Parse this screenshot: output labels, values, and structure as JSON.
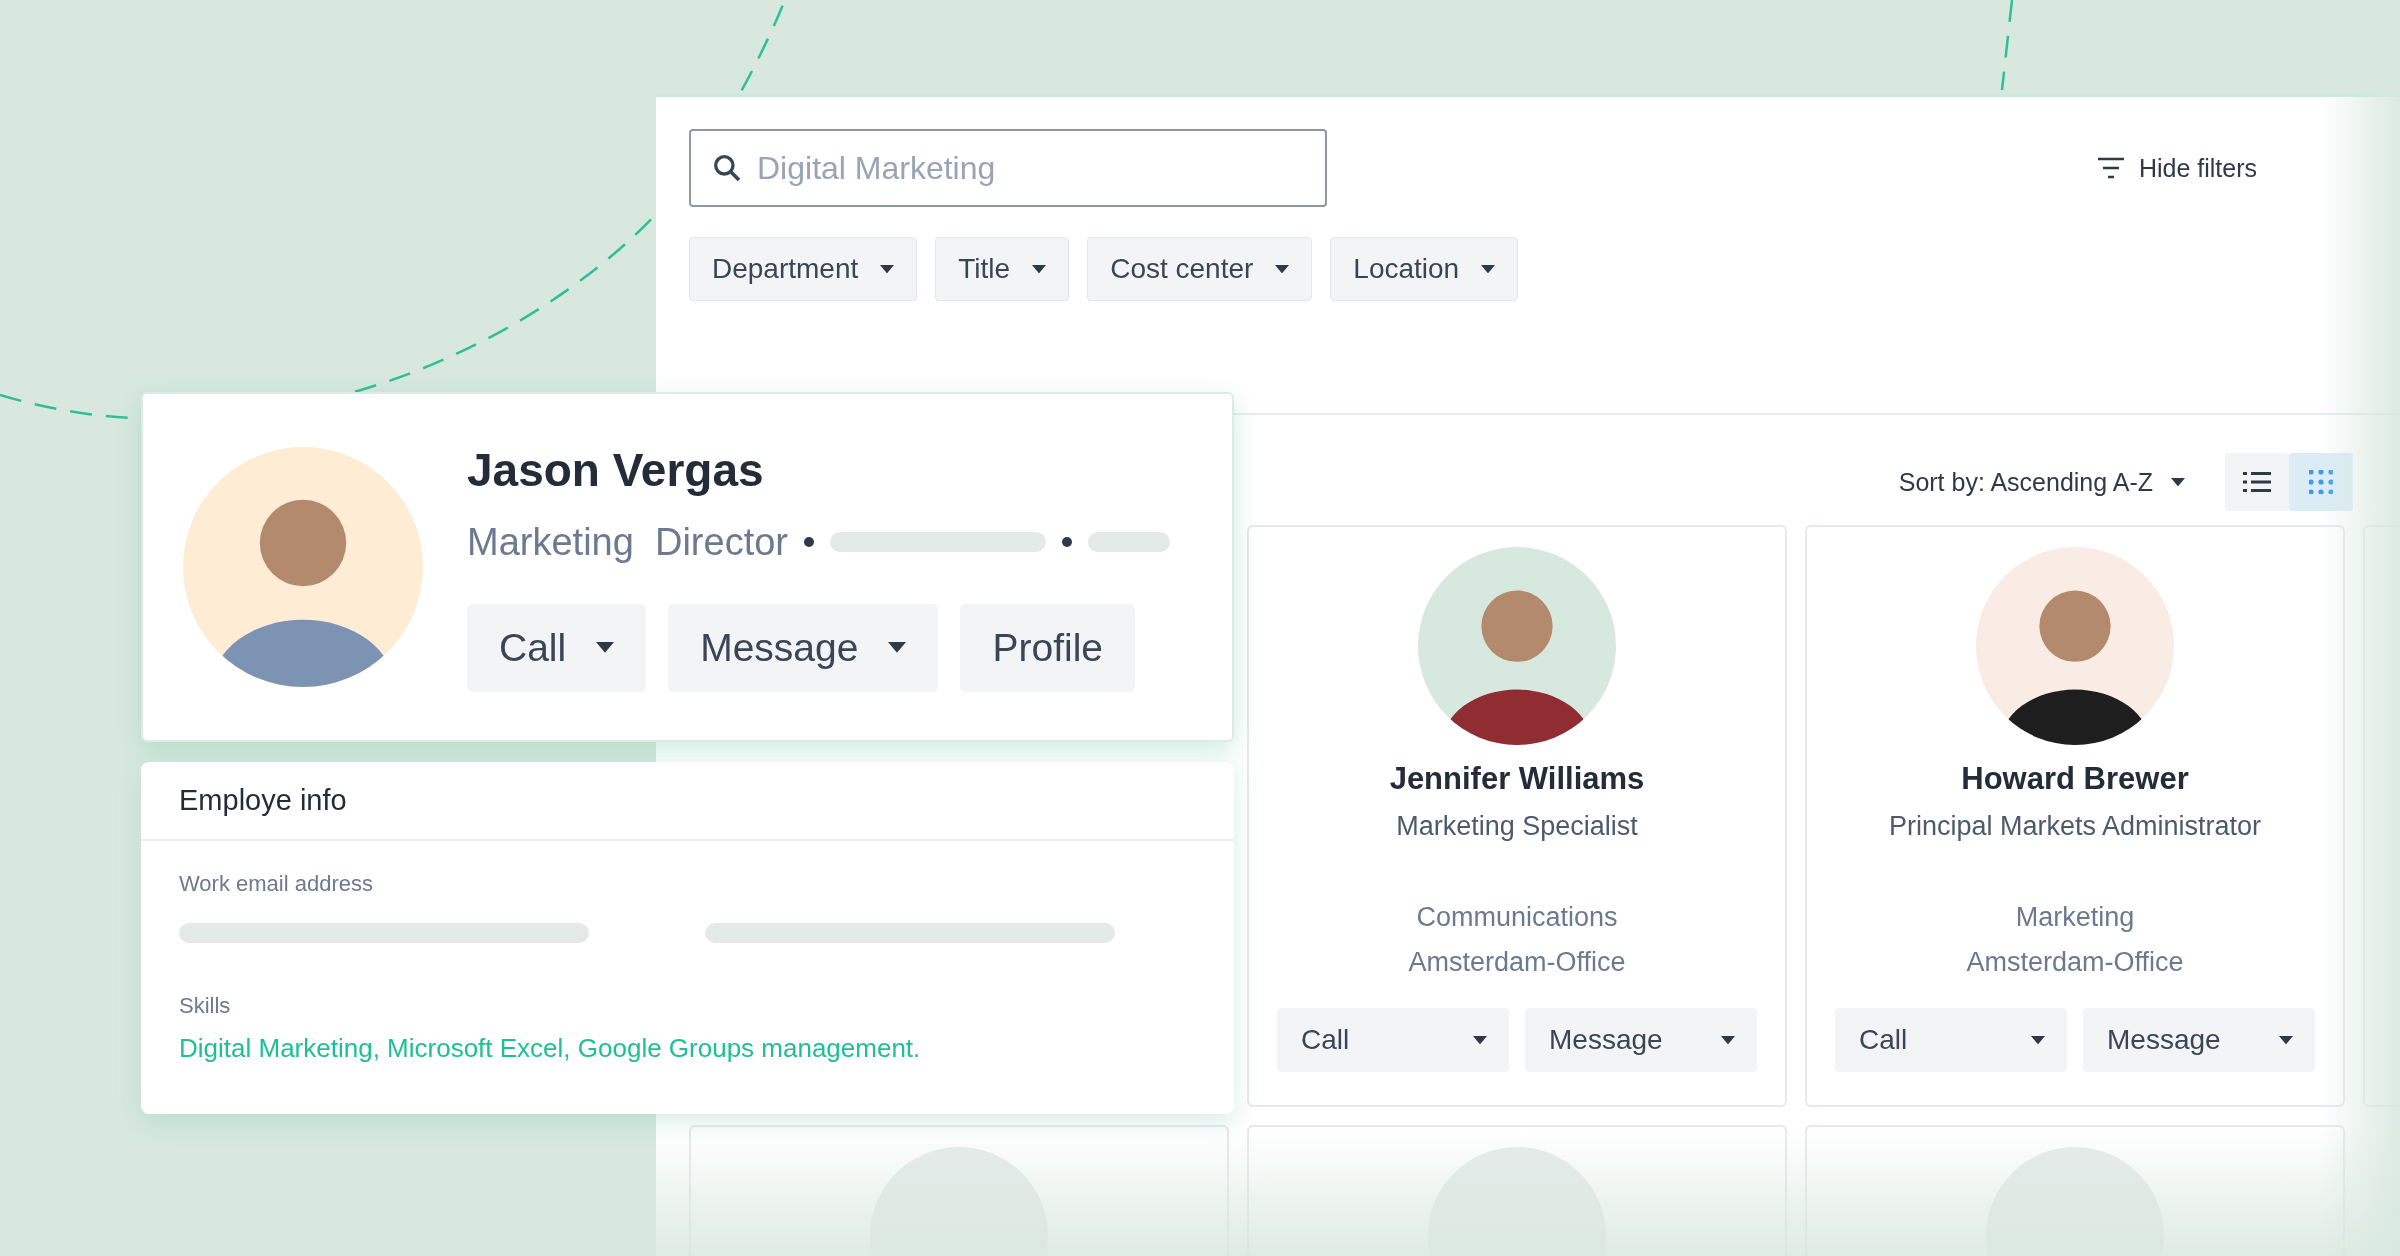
{
  "search": {
    "placeholder": "Digital Marketing"
  },
  "hide_filters": "Hide filters",
  "filters": [
    {
      "label": "Department"
    },
    {
      "label": "Title"
    },
    {
      "label": "Cost center"
    },
    {
      "label": "Location"
    }
  ],
  "sort": "Sort by: Ascending A-Z",
  "view_toggle": [
    {
      "kind": "list",
      "selected": false
    },
    {
      "kind": "grid",
      "selected": true
    }
  ],
  "cards": [
    {
      "kind": "hidden"
    },
    {
      "kind": "person",
      "name": "Jennifer Williams",
      "role": "Marketing Specialist",
      "department": "Communications",
      "office": "Amsterdam-Office",
      "buttons": [
        "Call",
        "Message"
      ]
    },
    {
      "kind": "person",
      "name": "Howard Brewer",
      "role": "Principal Markets Administrator",
      "department": "Marketing",
      "office": "Amsterdam-Office",
      "buttons": [
        "Call",
        "Message"
      ]
    },
    {
      "kind": "partial"
    },
    {
      "kind": "placeholder"
    },
    {
      "kind": "placeholder"
    },
    {
      "kind": "placeholder"
    }
  ],
  "profile": {
    "name": "Jason Vergas",
    "title": "Marketing  Director",
    "buttons": [
      {
        "label": "Call",
        "dropdown": true
      },
      {
        "label": "Message",
        "dropdown": true
      },
      {
        "label": "Profile",
        "dropdown": false
      }
    ]
  },
  "employee_info": {
    "title": "Employe info",
    "email_label": "Work email address",
    "skills_label": "Skills",
    "skills": "Digital Marketing, Microsoft Excel, Google Groups management."
  }
}
